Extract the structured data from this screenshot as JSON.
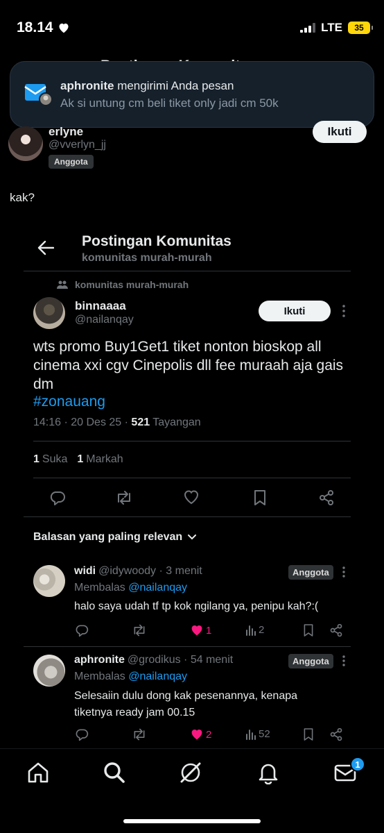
{
  "status_bar": {
    "time": "18.14",
    "network": "LTE",
    "battery": "35"
  },
  "ghost_title": "Postingan Komunitas",
  "notification": {
    "sender": "aphronite",
    "action": "mengirimi Anda pesan",
    "message": "Ak si untung cm beli tiket only jadi cm 50k"
  },
  "profile": {
    "name": "erlyne",
    "handle": "@vverlyn_jj",
    "badge": "Anggota",
    "follow_label": "Ikuti"
  },
  "message_text": "kak?",
  "embedded": {
    "header": {
      "title": "Postingan Komunitas",
      "subtitle": "komunitas murah-murah"
    },
    "community_label": "komunitas murah-murah",
    "post": {
      "name": "binnaaaa",
      "handle": "@nailanqay",
      "follow_label": "Ikuti",
      "text": "wts promo Buy1Get1 tiket nonton bioskop all cinema xxi cgv Cinepolis dll fee muraah aja gais dm",
      "hashtag": "#zonauang",
      "meta_time": "14:16 · 20 Des 25 · ",
      "views_count": "521",
      "views_label": "Tayangan",
      "likes_count": "1",
      "likes_label": "Suka",
      "bookmarks_count": "1",
      "bookmarks_label": "Markah"
    },
    "replies_sort_label": "Balasan yang paling relevan",
    "replies": [
      {
        "name": "widi",
        "meta": "@idywoody · 3 menit",
        "badge": "Anggota",
        "replying_prefix": "Membalas",
        "replying_to": "@nailanqay",
        "text": "halo saya udah tf tp kok ngilang ya, penipu kah?:(",
        "likes": "1",
        "views": "2"
      },
      {
        "name": "aphronite",
        "meta": "@grodikus · 54 menit",
        "badge": "Anggota",
        "replying_prefix": "Membalas",
        "replying_to": "@nailanqay",
        "text": "Selesaiin dulu dong kak pesenannya, kenapa tiketnya ready jam 00.15",
        "likes": "2",
        "views": "52"
      }
    ]
  },
  "bottom_nav": {
    "items": [
      "home-icon",
      "search-icon",
      "grok-icon",
      "notifications-icon",
      "messages-icon"
    ],
    "messages_badge": "1"
  },
  "colors": {
    "accent": "#1d9bf0",
    "like": "#f91880",
    "background": "#000000"
  }
}
